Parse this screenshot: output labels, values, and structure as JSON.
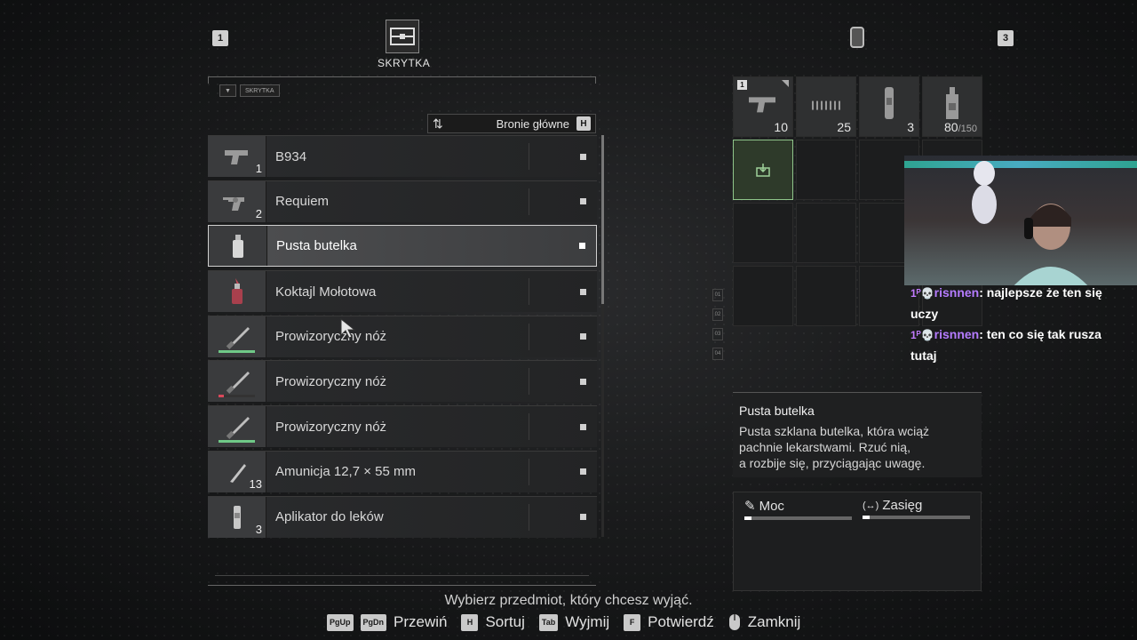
{
  "header": {
    "left_page_key": "1",
    "right_page_key": "3",
    "stash_label": "SKRYTKA"
  },
  "filter": {
    "icon": "filter-icon",
    "chip_label": "SKRYTKA"
  },
  "sort": {
    "label": "Bronie główne",
    "key": "H"
  },
  "items": [
    {
      "name": "B934",
      "count": "1",
      "icon": "pistol-icon",
      "selected": false
    },
    {
      "name": "Requiem",
      "count": "2",
      "icon": "revolver-icon",
      "selected": false
    },
    {
      "name": "Pusta butelka",
      "count": "",
      "icon": "bottle-icon",
      "selected": true
    },
    {
      "name": "Koktajl Mołotowa",
      "count": "",
      "icon": "molotov-icon",
      "selected": false
    },
    {
      "name": "Prowizoryczny nóż",
      "count": "",
      "icon": "knife-icon",
      "durability": 1.0,
      "selected": false
    },
    {
      "name": "Prowizoryczny nóż",
      "count": "",
      "icon": "knife-icon",
      "durability": 0.05,
      "selected": false
    },
    {
      "name": "Prowizoryczny nóż",
      "count": "",
      "icon": "knife-icon",
      "durability": 1.0,
      "selected": false
    },
    {
      "name": "Amunicja 12,7 × 55 mm",
      "count": "13",
      "icon": "ammo-icon",
      "selected": false
    },
    {
      "name": "Aplikator do leków",
      "count": "3",
      "icon": "injector-icon",
      "selected": false
    }
  ],
  "hint": "Wybierz przedmiot, który chcesz wyjąć.",
  "controls": [
    {
      "keys": [
        "PgUp",
        "PgDn"
      ],
      "label": "Przewiń"
    },
    {
      "keys": [
        "H"
      ],
      "label": "Sortuj"
    },
    {
      "keys": [
        "Tab"
      ],
      "label": "Wyjmij"
    },
    {
      "keys": [
        "F"
      ],
      "label": "Potwierdź"
    },
    {
      "keys": [
        "mouse"
      ],
      "label": "Zamknij"
    }
  ],
  "inventory": {
    "slots": [
      {
        "icon": "pistol-icon",
        "qty": "10",
        "tag": "1"
      },
      {
        "icon": "bullets-icon",
        "qty": "25"
      },
      {
        "icon": "canister-icon",
        "qty": "3"
      },
      {
        "icon": "can-icon",
        "qty": "80",
        "max": "/150"
      }
    ],
    "side_marks": [
      "01",
      "02",
      "03",
      "04"
    ]
  },
  "description": {
    "title": "Pusta butelka",
    "text": "Pusta szklana butelka, która wciąż\npachnie lekarstwami. Rzuć nią,\na rozbije się, przyciągając uwagę."
  },
  "stats": [
    {
      "label": "Moc",
      "icon": "power-icon"
    },
    {
      "label": "Zasięg",
      "icon": "range-icon"
    }
  ],
  "chat": [
    {
      "user": "risnnen",
      "message": "najlepsze że ten się uczy"
    },
    {
      "user": "risnnen",
      "message": "ten co się tak rusza tutaj"
    }
  ]
}
